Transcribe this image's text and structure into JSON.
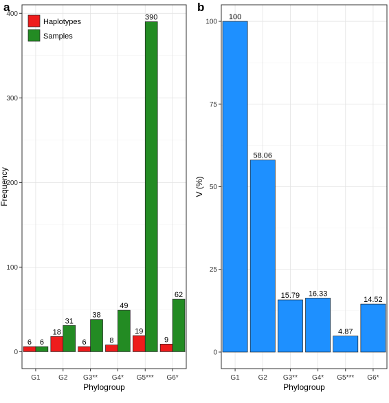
{
  "colors": {
    "haplotypes": "#ee1c1c",
    "samples": "#238b23",
    "v_percent": "#1e90ff"
  },
  "chart_data": [
    {
      "panel": "a",
      "type": "bar",
      "categories": [
        "G1",
        "G2",
        "G3**",
        "G4*",
        "G5***",
        "G6*"
      ],
      "series": [
        {
          "name": "Haplotypes",
          "values": [
            6,
            18,
            6,
            8,
            19,
            9
          ]
        },
        {
          "name": "Samples",
          "values": [
            6,
            31,
            38,
            49,
            390,
            62
          ]
        }
      ],
      "data_labels": {
        "Haplotypes": [
          "6",
          "18",
          "6",
          "8",
          "19",
          "9"
        ],
        "Samples": [
          "6",
          "31",
          "38",
          "49",
          "390",
          "62"
        ]
      },
      "xlabel": "Phylogroup",
      "ylabel": "Frequency",
      "yticks": [
        0,
        100,
        200,
        300,
        400
      ],
      "ylim": [
        -20,
        410
      ],
      "grid": true,
      "legend": "top-left"
    },
    {
      "panel": "b",
      "type": "bar",
      "categories": [
        "G1",
        "G2",
        "G3**",
        "G4*",
        "G5***",
        "G6*"
      ],
      "series": [
        {
          "values": [
            100,
            58.06,
            15.79,
            16.33,
            4.87,
            14.52
          ]
        }
      ],
      "data_labels": [
        "100",
        "58.06",
        "15.79",
        "16.33",
        "4.87",
        "14.52"
      ],
      "xlabel": "Phylogroup",
      "ylabel": "V (%)",
      "yticks": [
        0,
        25,
        50,
        75,
        100
      ],
      "ylim": [
        -5,
        105
      ],
      "grid": true
    }
  ]
}
